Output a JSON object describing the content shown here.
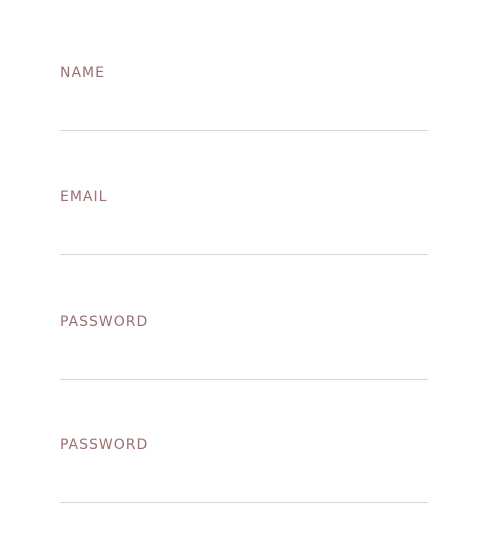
{
  "form": {
    "fields": [
      {
        "label": "NAME",
        "value": "",
        "placeholder": "",
        "type": "text"
      },
      {
        "label": "EMAIL",
        "value": "",
        "placeholder": "",
        "type": "email"
      },
      {
        "label": "PASSWORD",
        "value": "",
        "placeholder": "",
        "type": "password"
      },
      {
        "label": "PASSWORD",
        "value": "",
        "placeholder": "",
        "type": "password"
      }
    ]
  },
  "colors": {
    "label": "#9c6f70",
    "underline": "#d8d8d8",
    "background": "#ffffff"
  }
}
